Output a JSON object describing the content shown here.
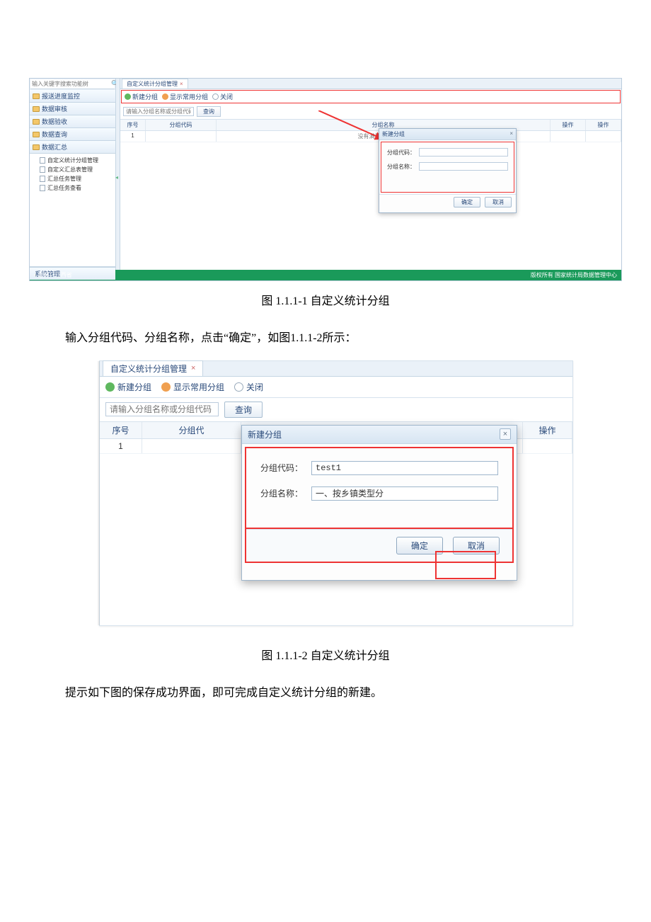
{
  "fig1": {
    "sidebar": {
      "search_placeholder": "输入关键字搜索功能树",
      "nav_items": [
        "报送进度监控",
        "数据审核",
        "数据验收",
        "数据查询",
        "数据汇总"
      ],
      "tree_items": [
        "自定义统计分组管理",
        "自定义汇总表管理",
        "汇总任务管理",
        "汇总任务查看"
      ],
      "sys_label": "系统管理"
    },
    "tab_title": "自定义统计分组管理",
    "toolbar": {
      "new": "新建分组",
      "show": "显示常用分组",
      "close": "关闭"
    },
    "filter": {
      "placeholder": "请输入分组名称或分组代码",
      "query": "查询"
    },
    "grid": {
      "headers": [
        "序号",
        "分组代码",
        "分组名称",
        "操作",
        "操作"
      ],
      "row_idx": "1",
      "empty_msg": "没有满足条件的记录"
    },
    "dialog": {
      "title": "新建分组",
      "code_label": "分组代码：",
      "name_label": "分组名称：",
      "code_value": "",
      "name_value": "",
      "ok": "确定",
      "cancel": "取消"
    },
    "footer": {
      "left": "您好！江西省",
      "right": "版权所有 国家统计局数据管理中心"
    }
  },
  "caption1": "图 1.1.1-1 自定义统计分组",
  "para1": "输入分组代码、分组名称，点击“确定”，如图1.1.1-2所示：",
  "fig2": {
    "tab_title": "自定义统计分组管理",
    "toolbar": {
      "new": "新建分组",
      "show": "显示常用分组",
      "close": "关闭"
    },
    "filter": {
      "placeholder": "请输入分组名称或分组代码",
      "query": "查询"
    },
    "grid": {
      "headers": [
        "序号",
        "分组代码",
        "",
        "操作"
      ],
      "code_trunc": "分组代",
      "row_idx": "1"
    },
    "dialog": {
      "title": "新建分组",
      "code_label": "分组代码：",
      "name_label": "分组名称：",
      "code_value": "test1",
      "name_value": "一、按乡镇类型分",
      "ok": "确定",
      "cancel": "取消"
    }
  },
  "caption2": "图 1.1.1-2 自定义统计分组",
  "para2": "提示如下图的保存成功界面，即可完成自定义统计分组的新建。"
}
